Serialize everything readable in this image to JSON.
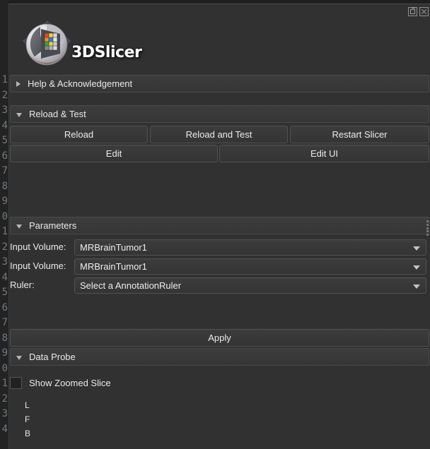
{
  "window": {
    "title": "3DSlicer",
    "titlebar_buttons": [
      {
        "name": "float-button",
        "icon": "undock-icon",
        "label": ""
      },
      {
        "name": "close-button",
        "icon": "close-icon",
        "label": ""
      }
    ]
  },
  "branding": {
    "logo_icon": "slicer-logo-icon",
    "wordmark": "3DSlicer"
  },
  "sections": {
    "help": {
      "label": "Help & Acknowledgement",
      "expanded": false,
      "arrow_icon": "chevron-right-icon"
    },
    "reload": {
      "label": "Reload & Test",
      "expanded": true,
      "arrow_icon": "chevron-down-icon"
    },
    "parameters": {
      "label": "Parameters",
      "expanded": true,
      "arrow_icon": "chevron-down-icon"
    },
    "data_probe": {
      "label": "Data Probe",
      "expanded": true,
      "arrow_icon": "chevron-down-icon"
    }
  },
  "reload_buttons": {
    "reload": "Reload",
    "reload_and_test": "Reload and Test",
    "restart_slicer": "Restart Slicer",
    "edit": "Edit",
    "edit_ui": "Edit UI"
  },
  "parameters": {
    "rows": [
      {
        "label": "Input Volume:",
        "value": "MRBrainTumor1",
        "arrow_icon": "chevron-down-icon"
      },
      {
        "label": "Input Volume:",
        "value": "MRBrainTumor1",
        "arrow_icon": "chevron-down-icon"
      },
      {
        "label": "Ruler:",
        "value": "Select a AnnotationRuler",
        "arrow_icon": "chevron-down-icon"
      }
    ],
    "apply_label": "Apply"
  },
  "data_probe": {
    "show_zoomed_slice": {
      "label": "Show Zoomed Slice",
      "checked": false
    },
    "orientation_rows": [
      "L",
      "F",
      "B"
    ]
  },
  "gutter": {
    "line_numbers": [
      "1",
      "2",
      "3",
      "4",
      "5",
      "6",
      "7",
      "8",
      "9",
      "0",
      "1",
      "2",
      "3",
      "4",
      "5",
      "6",
      "7",
      "8",
      "9",
      "0",
      "1",
      "2",
      "3",
      "4"
    ]
  },
  "colors": {
    "panel_background": "#313131",
    "window_background": "#232323",
    "section_header": "#3a3a3a",
    "button_face": "#383838",
    "border": "#525252",
    "text": "#e9e9e9",
    "gutter_text": "#6f7b84"
  }
}
